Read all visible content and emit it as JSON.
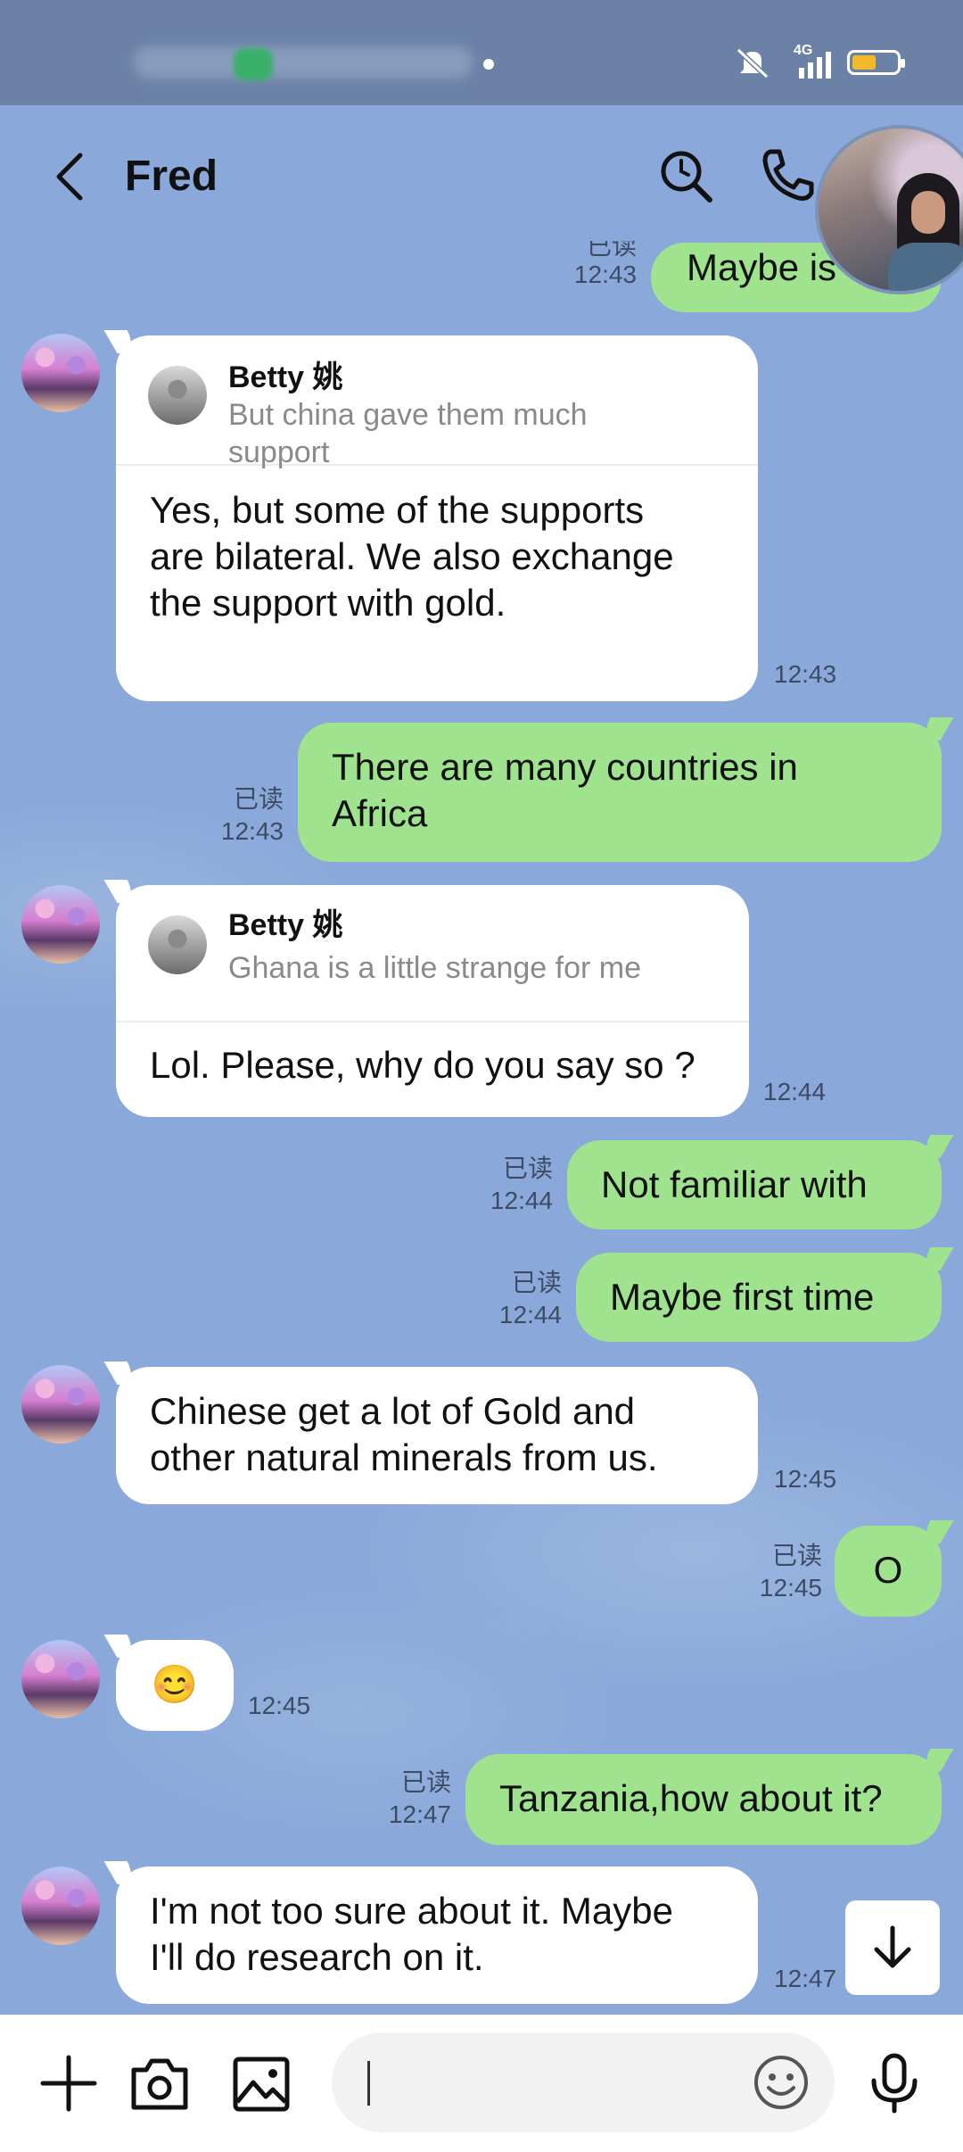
{
  "status_bar": {
    "network": "4G"
  },
  "header": {
    "title": "Fred"
  },
  "messages": [
    {
      "dir": "out",
      "text": "Maybe is",
      "read": "已读",
      "time": "12:43"
    },
    {
      "dir": "in",
      "reply_name": "Betty 姚",
      "reply_text": "But china gave them much\nsupport",
      "text": "Yes, but some of the supports\nare bilateral. We also exchange\nthe support with gold.",
      "time": "12:43"
    },
    {
      "dir": "out",
      "text": "There are many countries in\nAfrica",
      "read": "已读",
      "time": "12:43"
    },
    {
      "dir": "in",
      "reply_name": "Betty 姚",
      "reply_text": "Ghana is a little strange for me",
      "text": "Lol. Please, why do you say so ?",
      "time": "12:44"
    },
    {
      "dir": "out",
      "text": "Not familiar with",
      "read": "已读",
      "time": "12:44"
    },
    {
      "dir": "out",
      "text": "Maybe first time",
      "read": "已读",
      "time": "12:44"
    },
    {
      "dir": "in",
      "text": "Chinese get a lot of Gold and\nother natural minerals from us.",
      "time": "12:45"
    },
    {
      "dir": "out",
      "text": "O",
      "read": "已读",
      "time": "12:45"
    },
    {
      "dir": "in",
      "text": "😊",
      "time": "12:45"
    },
    {
      "dir": "out",
      "text": "Tanzania,how about it?",
      "read": "已读",
      "time": "12:47"
    },
    {
      "dir": "in",
      "text": "I'm not too sure about it. Maybe\nI'll do research on it.",
      "time": "12:47"
    }
  ],
  "colors": {
    "out_bubble": "#9fe38f",
    "in_bubble": "#ffffff",
    "background": "#8aa9da",
    "status_bar": "#6b82a6"
  },
  "icons": [
    "back-icon",
    "search-icon",
    "phone-icon",
    "plus-icon",
    "camera-icon",
    "image-icon",
    "emoji-icon",
    "mic-icon",
    "arrow-down-icon"
  ]
}
